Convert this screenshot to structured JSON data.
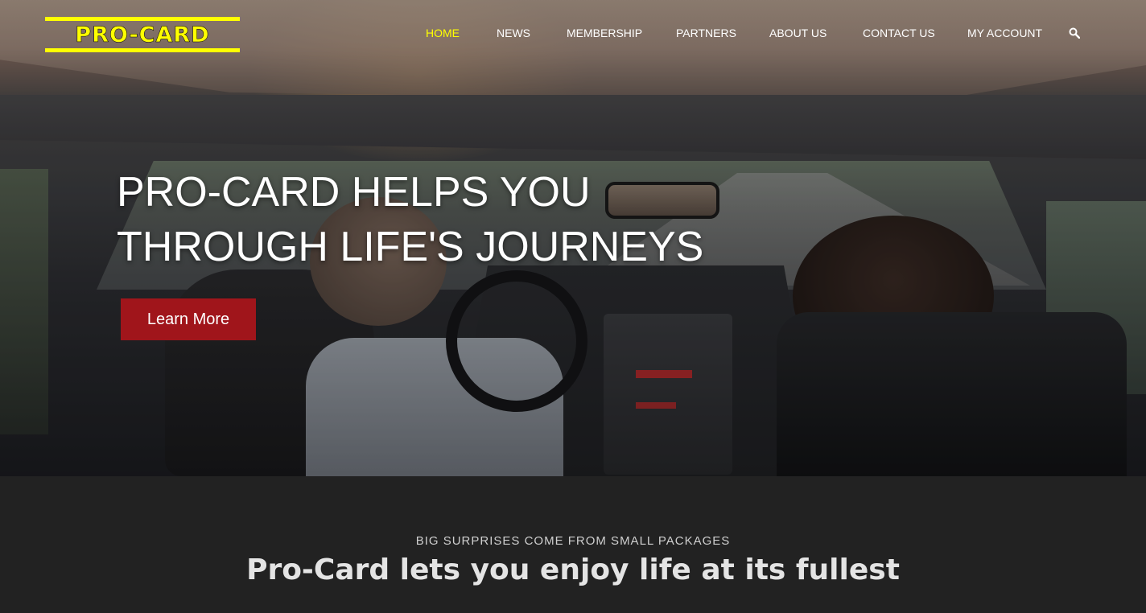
{
  "brand": {
    "logo_text": "PRO-CARD",
    "logo_color": "#ffff00"
  },
  "nav": {
    "items": [
      {
        "label": "HOME",
        "active": true
      },
      {
        "label": "NEWS"
      },
      {
        "label": "MEMBERSHIP"
      },
      {
        "label": "PARTNERS"
      },
      {
        "label": "ABOUT US"
      },
      {
        "label": "CONTACT US"
      },
      {
        "label": "MY ACCOUNT"
      }
    ],
    "search_icon": "search-icon"
  },
  "hero": {
    "title_line1": "PRO-CARD HELPS YOU",
    "title_line2": "THROUGH LIFE'S JOURNEYS",
    "cta_label": "Learn More",
    "cta_color": "#a0151b"
  },
  "section": {
    "kicker": "BIG SURPRISES COME FROM SMALL PACKAGES",
    "headline": "Pro-Card lets you enjoy life at its fullest",
    "background": "#222222"
  }
}
